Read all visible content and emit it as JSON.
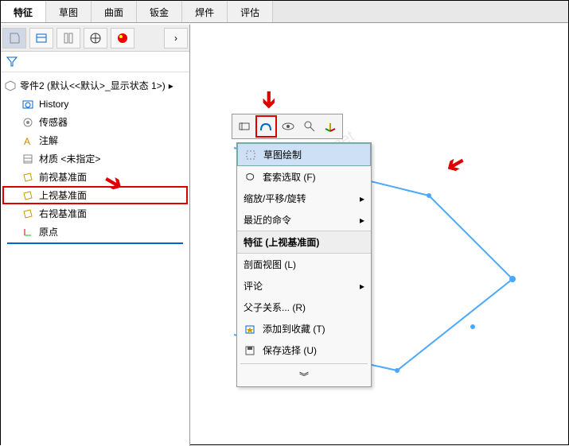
{
  "tabs": {
    "t0": "特征",
    "t1": "草图",
    "t2": "曲面",
    "t3": "钣金",
    "t4": "焊件",
    "t5": "评估"
  },
  "tree": {
    "root": "零件2 (默认<<默认>_显示状态 1>)",
    "history": "History",
    "sensors": "传感器",
    "annotations": "注解",
    "material": "材质 <未指定>",
    "front": "前视基准面",
    "top": "上视基准面",
    "right": "右视基准面",
    "origin": "原点"
  },
  "context": {
    "sketch_draw": "草图绘制",
    "lasso": "套索选取 (F)",
    "zoom": "缩放/平移/旋转",
    "recent": "最近的命令",
    "feature_header": "特征 (上视基准面)",
    "section": "剖面视图 (L)",
    "comment": "评论",
    "parent": "父子关系... (R)",
    "favorite": "添加到收藏 (T)",
    "save_sel": "保存选择 (U)"
  },
  "icons": {
    "chevron": "▸",
    "chevron_down": "»",
    "expand_down": "︾"
  }
}
